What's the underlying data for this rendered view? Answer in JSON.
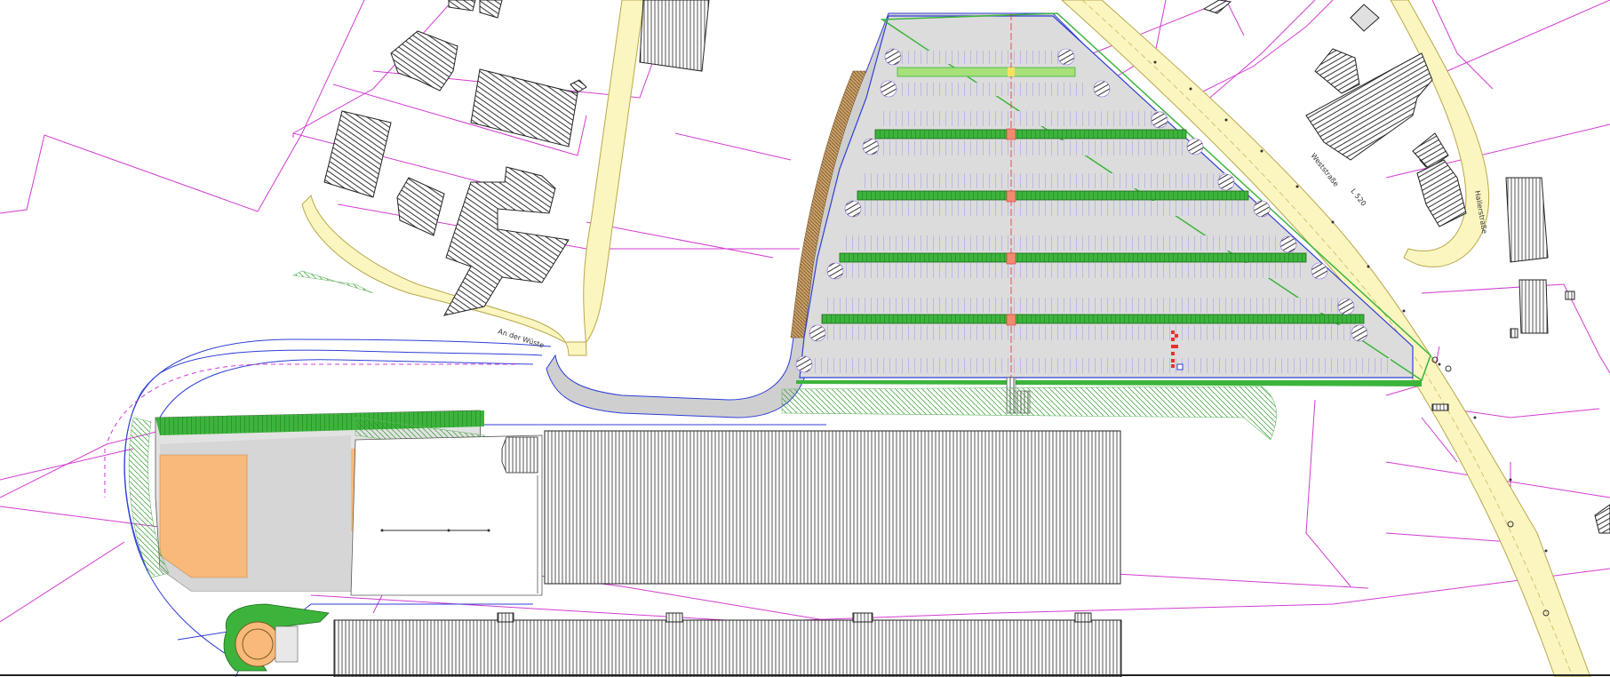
{
  "map": {
    "street_labels": {
      "an_der_wueste": "An der Wüste",
      "weststrasse": "Weststraße",
      "l520": "L 520",
      "hallerstrasse": "Hallerstraße"
    },
    "colors": {
      "parcel_line": "#d23cd2",
      "road_fill": "#fbf5c0",
      "road_edge": "#b8a84a",
      "parking_fill": "#dcdcdc",
      "green_strip": "#3cb43c",
      "light_green": "#a8e07a",
      "water_line": "#2f3fd6",
      "hatch": "#444444",
      "orange_area": "#f9b97a",
      "red_marker": "#e83030"
    }
  }
}
